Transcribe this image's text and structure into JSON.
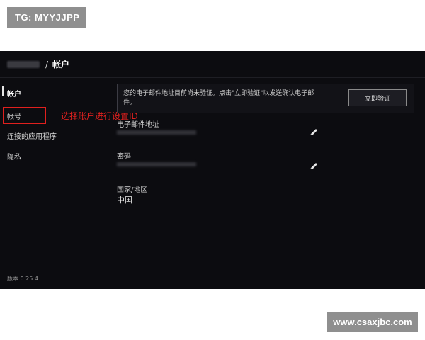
{
  "watermarks": {
    "top_left": "TG: MYYJJPP",
    "bottom_right": "www.csaxjbc.com"
  },
  "header": {
    "separator": "/",
    "page_title": "帐户"
  },
  "sidebar": {
    "items": [
      {
        "label": "帐户",
        "active": true
      },
      {
        "label": "帐号",
        "active": false
      },
      {
        "label": "连接的应用程序",
        "active": false
      },
      {
        "label": "隐私",
        "active": false
      }
    ],
    "version": "版本 0.25.4"
  },
  "annotation": {
    "note": "选择账户进行设置ID",
    "color": "#e0201e"
  },
  "notice": {
    "text": "您的电子邮件地址目前尚未验证。点击\"立即验证\"以发送确认电子邮件。",
    "button_label": "立即验证"
  },
  "fields": {
    "email_label": "电子邮件地址",
    "password_label": "密码",
    "region_label": "国家/地区",
    "region_value": "中国"
  },
  "icons": {
    "email_edit": "pencil-icon",
    "password_edit": "pencil-icon"
  }
}
